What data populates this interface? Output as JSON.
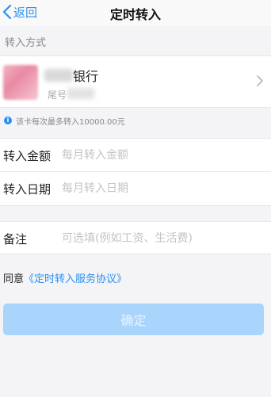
{
  "nav": {
    "back_label": "返回",
    "title": "定时转入"
  },
  "section": {
    "transfer_method_label": "转入方式"
  },
  "card": {
    "bank_name": "银行",
    "tail_label": "尾号"
  },
  "limit_note": "该卡每次最多转入10000.00元",
  "form": {
    "amount": {
      "label": "转入金额",
      "placeholder": "每月转入金额",
      "value": ""
    },
    "date": {
      "label": "转入日期",
      "placeholder": "每月转入日期",
      "value": ""
    },
    "memo": {
      "label": "备注",
      "placeholder": "可选填(例如工资、生活费)",
      "value": ""
    }
  },
  "agreement": {
    "prefix": "同意",
    "link": "《定时转入服务协议》"
  },
  "confirm_label": "确定",
  "colors": {
    "accent": "#2b8ff0",
    "button_disabled": "#a9d4fb",
    "background": "#f4f4f6"
  }
}
